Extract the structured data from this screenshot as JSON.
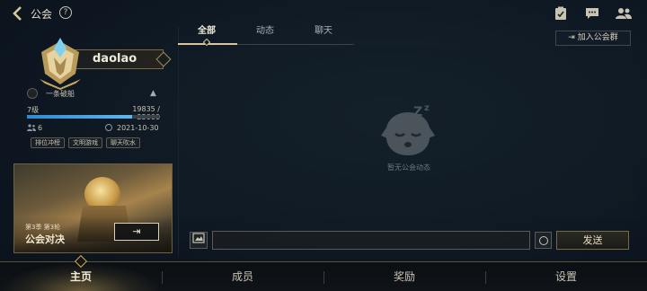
{
  "header": {
    "title": "公会",
    "help_label": "?",
    "join_button": "加入公会群"
  },
  "profile": {
    "name": "daolao",
    "motto": "一条破船",
    "level": "7级",
    "exp_text": "19835 / 25000",
    "exp_fraction": 0.7934,
    "members": "6",
    "date": "2021-10-30",
    "tags": [
      "排位冲榜",
      "文明游戏",
      "聊天吹水"
    ]
  },
  "event": {
    "season": "第3季 第3轮",
    "title": "公会对决",
    "button_glyph": "⇥"
  },
  "tabs": [
    {
      "label": "全部",
      "active": true
    },
    {
      "label": "动态",
      "active": false
    },
    {
      "label": "聊天",
      "active": false
    }
  ],
  "feed": {
    "empty_text": "暂无公会动态"
  },
  "chat": {
    "input_value": "",
    "send_label": "发送"
  },
  "nav": [
    {
      "label": "主页",
      "active": true
    },
    {
      "label": "成员",
      "active": false
    },
    {
      "label": "奖励",
      "active": false
    },
    {
      "label": "设置",
      "active": false
    }
  ],
  "colors": {
    "accent_gold": "#d8c79a",
    "exp_blue": "#2e8bd1",
    "background": "#0f1923"
  },
  "icons": [
    "back-arrow-icon",
    "help-icon",
    "checklist-icon",
    "chat-bubble-icon",
    "members-icon",
    "sleeping-face-icon",
    "image-icon",
    "emoji-icon",
    "warning-icon",
    "clock-icon"
  ]
}
